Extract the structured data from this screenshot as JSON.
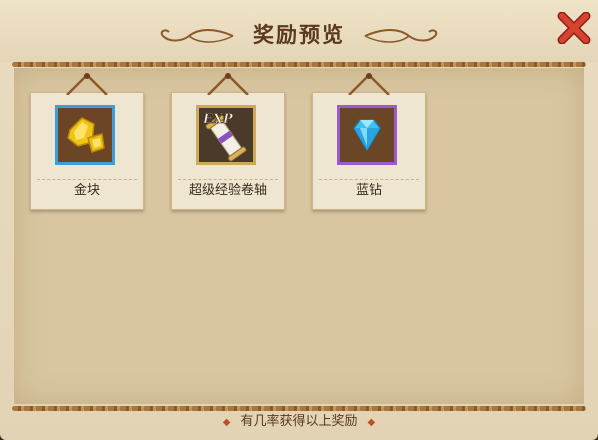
{
  "dialog": {
    "title": "奖励预览",
    "close_icon": "close-x-icon"
  },
  "rewards": [
    {
      "name": "金块",
      "icon": "gold-nugget-icon"
    },
    {
      "name": "超级经验卷轴",
      "icon": "exp-scroll-icon",
      "badge": "EXP"
    },
    {
      "name": "蓝钻",
      "icon": "blue-diamond-icon"
    }
  ],
  "footer": {
    "note": "有几率获得以上奖励"
  },
  "colors": {
    "close_red": "#d8432f",
    "title_brown": "#5a3a1e",
    "gold_border": "#3c9fd8",
    "scroll_border": "#cfa95a",
    "diamond_border": "#9a5cc8"
  }
}
